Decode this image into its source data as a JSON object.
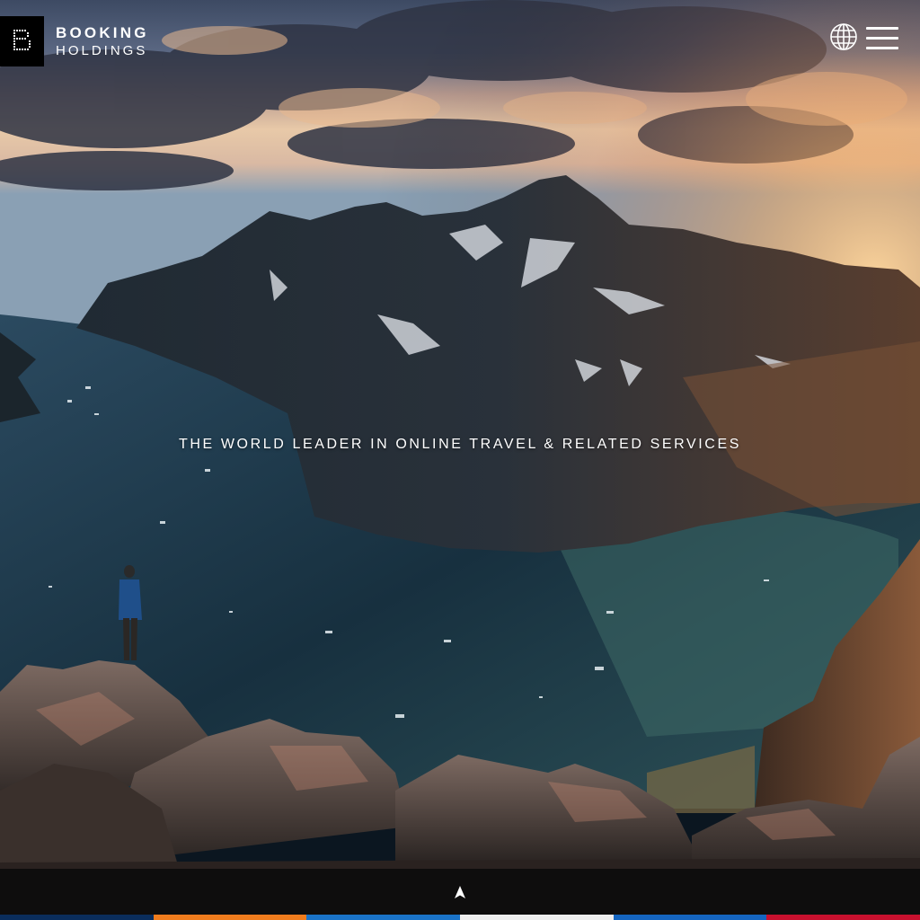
{
  "header": {
    "logo_line1": "BOOKING",
    "logo_line2": "HOLDINGS",
    "logo_icon": "booking-holdings-b-mark",
    "language_icon": "globe-icon",
    "menu_icon": "hamburger-menu-icon"
  },
  "hero": {
    "tagline": "THE WORLD LEADER IN ONLINE TRAVEL & RELATED SERVICES"
  },
  "footer": {
    "scroll_icon": "arrow-up-icon",
    "brand_stripe_colors": [
      "#0a2d5c",
      "#f07c1d",
      "#1a73c8",
      "#eeeeee",
      "#1565c0",
      "#c8102e"
    ]
  }
}
